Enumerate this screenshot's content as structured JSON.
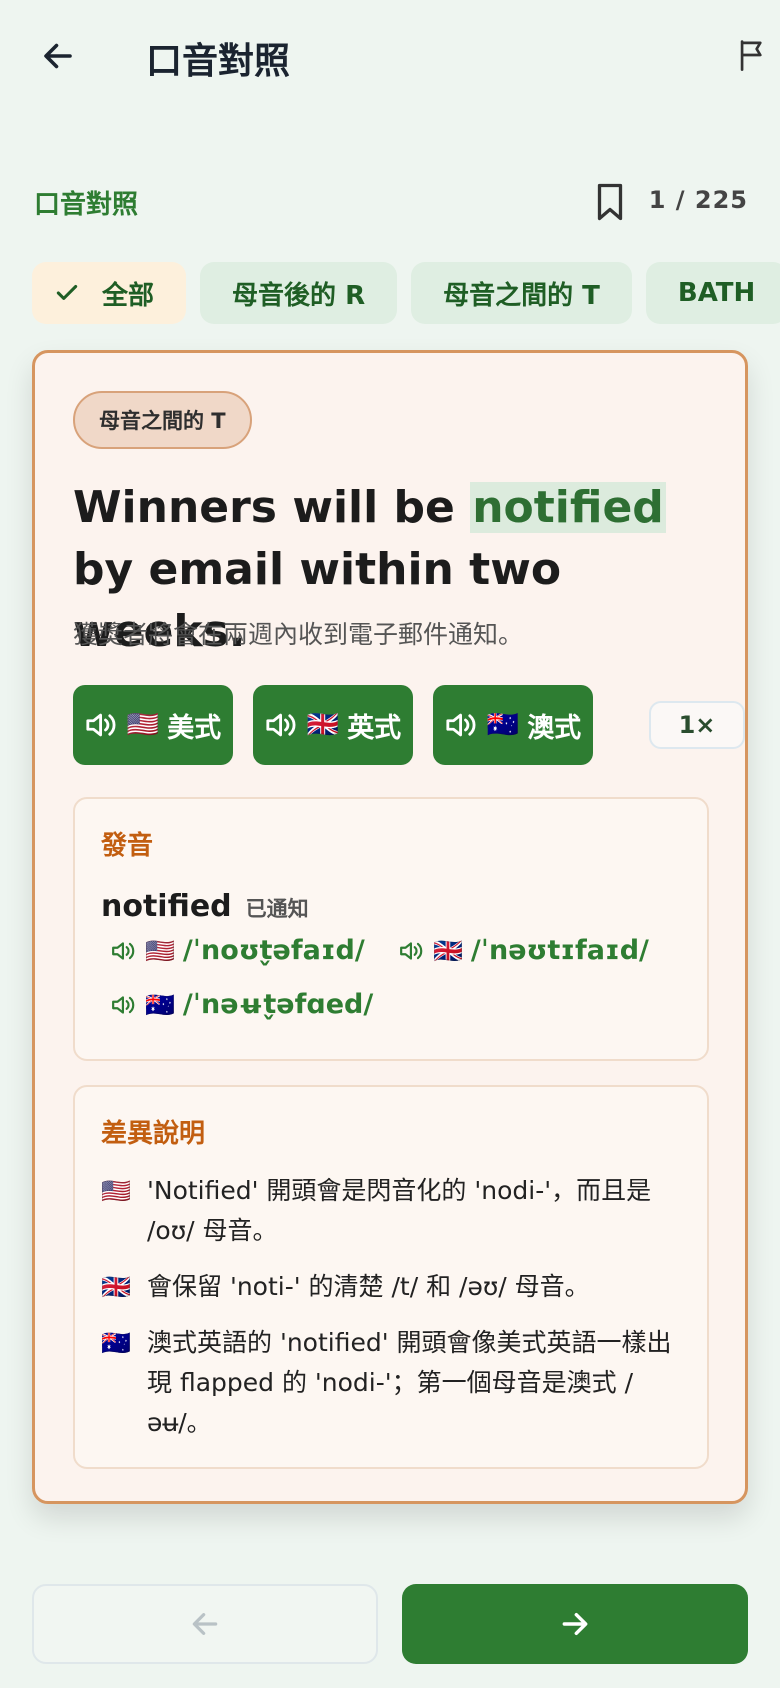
{
  "header": {
    "title": "口音對照",
    "back_icon": "arrow-left-icon",
    "report_icon": "flag-icon"
  },
  "section": {
    "title": "口音對照",
    "bookmark_icon": "bookmark-icon",
    "counter": "1 / 225"
  },
  "chips": [
    {
      "label": "全部",
      "selected": true
    },
    {
      "label": "母音後的 R",
      "selected": false
    },
    {
      "label": "母音之間的 T",
      "selected": false
    },
    {
      "label": "BATH",
      "selected": false
    }
  ],
  "card": {
    "tag": "母音之間的 T",
    "sentence_before": "Winners will be ",
    "sentence_highlight": "notified",
    "sentence_after": " by email within two weeks.",
    "translation": "獲獎者將會在兩週內收到電子郵件通知。",
    "audio_buttons": [
      {
        "flag": "🇺🇸",
        "label": "美式"
      },
      {
        "flag": "🇬🇧",
        "label": "英式"
      },
      {
        "flag": "🇦🇺",
        "label": "澳式"
      }
    ],
    "speed": "1×",
    "pronunciation": {
      "title": "發音",
      "word": "notified",
      "word_translation": "已通知",
      "ipa": [
        {
          "flag": "🇺🇸",
          "text": "/ˈnoʊt̬əfaɪd/"
        },
        {
          "flag": "🇬🇧",
          "text": "/ˈnəʊtɪfaɪd/"
        },
        {
          "flag": "🇦🇺",
          "text": "/ˈnəʉt̬əfɑed/"
        }
      ]
    },
    "differences": {
      "title": "差異說明",
      "notes": [
        {
          "flag": "🇺🇸",
          "text": "'Notified' 開頭會是閃音化的 'nodi-'，而且是 /oʊ/ 母音。"
        },
        {
          "flag": "🇬🇧",
          "text": "會保留 'noti-' 的清楚 /t/ 和 /əʊ/ 母音。"
        },
        {
          "flag": "🇦🇺",
          "text": "澳式英語的 'notified' 開頭會像美式英語一樣出現 flapped 的 'nodi-'；第一個母音是澳式 /əʉ/。"
        }
      ]
    }
  },
  "navigation": {
    "prev_icon": "arrow-left-icon",
    "next_icon": "arrow-right-icon",
    "prev_enabled": false
  },
  "colors": {
    "accent": "#2e7d32",
    "card_border": "#d6955f",
    "section_orange": "#c25e10",
    "background": "#eef5f0"
  }
}
